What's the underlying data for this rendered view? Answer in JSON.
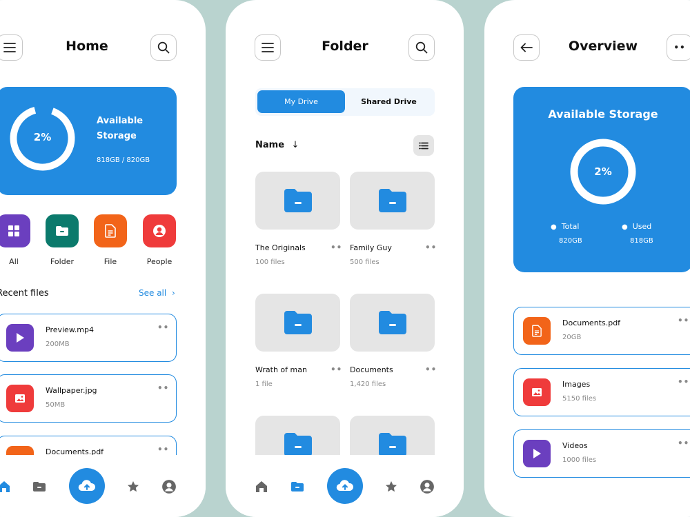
{
  "colors": {
    "accent": "#228be0",
    "purple": "#6b3fbf",
    "teal": "#0b7a6c",
    "orange": "#f26419",
    "red": "#ef3b3b",
    "background": "#b9d3cf"
  },
  "home": {
    "title": "Home",
    "storage": {
      "percent_label": "2%",
      "percent": 0.02,
      "title_line1": "Available",
      "title_line2": "Storage",
      "usage": "818GB / 820GB"
    },
    "categories": [
      {
        "label": "All",
        "icon": "grid-icon"
      },
      {
        "label": "Folder",
        "icon": "folder-icon"
      },
      {
        "label": "File",
        "icon": "file-icon"
      },
      {
        "label": "People",
        "icon": "person-icon"
      }
    ],
    "recent_title": "Recent files",
    "see_all": "See all",
    "recent_files": [
      {
        "name": "Preview.mp4",
        "size": "200MB",
        "icon": "play-icon"
      },
      {
        "name": "Wallpaper.jpg",
        "size": "50MB",
        "icon": "image-icon"
      },
      {
        "name": "Documents.pdf",
        "size": "",
        "icon": "document-icon"
      }
    ]
  },
  "folder": {
    "title": "Folder",
    "tabs": [
      "My Drive",
      "Shared Drive"
    ],
    "active_tab": "My Drive",
    "sort_label": "Name",
    "folders": [
      {
        "name": "The Originals",
        "count": "100 files"
      },
      {
        "name": "Family Guy",
        "count": "500 files"
      },
      {
        "name": "Wrath of man",
        "count": "1 file"
      },
      {
        "name": "Documents",
        "count": "1,420 files"
      }
    ]
  },
  "overview": {
    "title": "Overview",
    "storage": {
      "title": "Available Storage",
      "percent_label": "2%",
      "percent": 0.02,
      "total_label": "Total",
      "total_value": "820GB",
      "used_label": "Used",
      "used_value": "818GB"
    },
    "files": [
      {
        "name": "Documents.pdf",
        "sub": "20GB",
        "icon": "document-icon"
      },
      {
        "name": "Images",
        "sub": "5150 files",
        "icon": "image-icon"
      },
      {
        "name": "Videos",
        "sub": "1000 files",
        "icon": "play-icon"
      }
    ]
  },
  "nav": [
    "home-icon",
    "folder-icon",
    "upload-cloud-icon",
    "star-icon",
    "profile-icon"
  ]
}
